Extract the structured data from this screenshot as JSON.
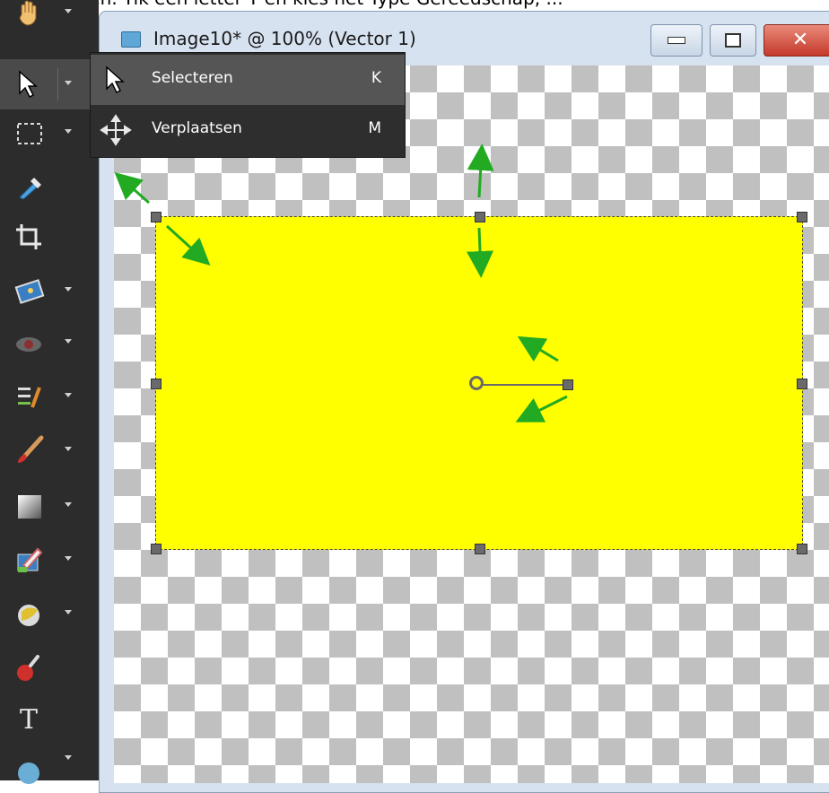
{
  "caption": "kan geven. Tik een letter Y en kies het Type Gereedschap, ...",
  "window": {
    "title": "Image10* @ 100% (Vector 1)",
    "close_glyph": "✕"
  },
  "menu": {
    "items": [
      {
        "label": "Selecteren",
        "shortcut": "K",
        "icon": "arrow-pointer-icon",
        "selected": true
      },
      {
        "label": "Verplaatsen",
        "shortcut": "M",
        "icon": "move-icon",
        "selected": false
      }
    ]
  },
  "toolbar": {
    "tools": [
      "pan-icon",
      "pick-icon",
      "selection-icon",
      "dropper-icon",
      "crop-icon",
      "picture-icon",
      "red-eye-icon",
      "retouch-icon",
      "paint-brush-icon",
      "gradient-icon",
      "fill-icon",
      "shape-icon",
      "clone-icon",
      "text-icon",
      "preset-shape-icon"
    ],
    "text_tool_glyph": "T"
  },
  "colors": {
    "object_fill": "#ffff00",
    "arrow": "#22aa22",
    "toolbar_bg": "#2c2c2c"
  }
}
